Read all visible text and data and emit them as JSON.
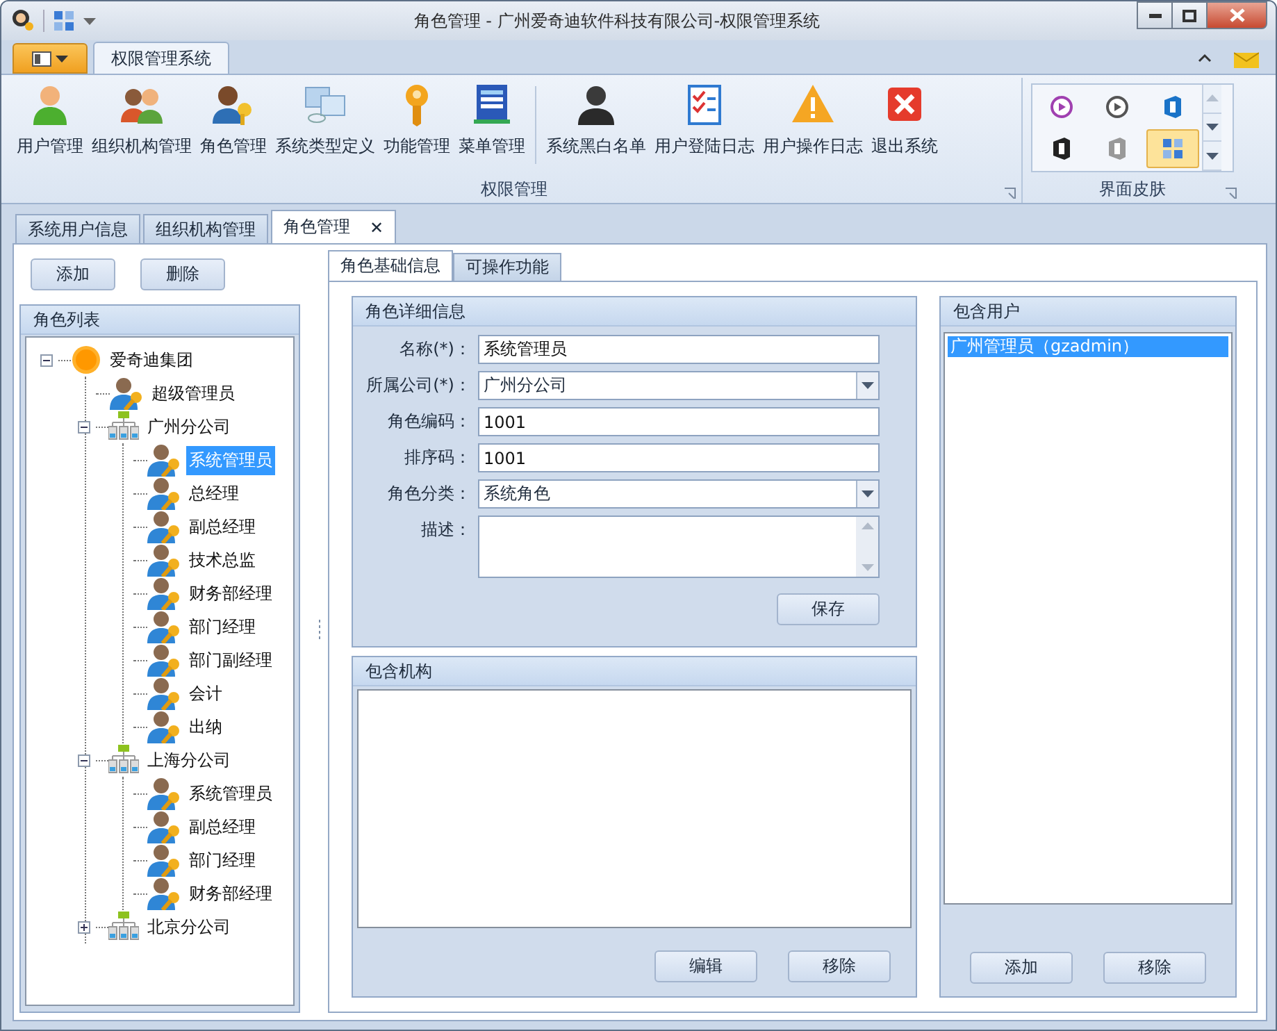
{
  "window": {
    "title": "角色管理 - 广州爱奇迪软件科技有限公司-权限管理系统"
  },
  "ribbon_tabs": [
    {
      "label": "权限管理系统",
      "selected": true
    }
  ],
  "ribbon_groups": [
    {
      "label": "权限管理",
      "sections": [
        [
          {
            "label": "用户管理"
          },
          {
            "label": "组织机构管理"
          },
          {
            "label": "角色管理"
          },
          {
            "label": "系统类型定义"
          },
          {
            "label": "功能管理"
          },
          {
            "label": "菜单管理"
          }
        ],
        [
          {
            "label": "系统黑白名单"
          },
          {
            "label": "用户登陆日志"
          },
          {
            "label": "用户操作日志"
          },
          {
            "label": "退出系统"
          }
        ]
      ]
    }
  ],
  "skin_group": {
    "label": "界面皮肤",
    "skins": [
      {
        "selected": false
      },
      {
        "selected": false
      },
      {
        "selected": false
      },
      {
        "selected": false
      },
      {
        "selected": false
      },
      {
        "selected": true
      }
    ]
  },
  "doc_tabs": [
    {
      "label": "系统用户信息",
      "selected": false
    },
    {
      "label": "组织机构管理",
      "selected": false
    },
    {
      "label": "角色管理",
      "selected": true,
      "close": "✕"
    }
  ],
  "left_buttons": [
    "添加",
    "删除"
  ],
  "role_list": {
    "title": "角色列表",
    "tree": [
      {
        "label": "爱奇迪集团",
        "kind": "root",
        "selected": false,
        "expanded": true,
        "children": [
          {
            "label": "超级管理员",
            "kind": "role",
            "selected": false
          },
          {
            "label": "广州分公司",
            "kind": "org",
            "selected": false,
            "expanded": true,
            "children": [
              {
                "label": "系统管理员",
                "kind": "role",
                "selected": true
              },
              {
                "label": "总经理",
                "kind": "role",
                "selected": false
              },
              {
                "label": "副总经理",
                "kind": "role",
                "selected": false
              },
              {
                "label": "技术总监",
                "kind": "role",
                "selected": false
              },
              {
                "label": "财务部经理",
                "kind": "role",
                "selected": false
              },
              {
                "label": "部门经理",
                "kind": "role",
                "selected": false
              },
              {
                "label": "部门副经理",
                "kind": "role",
                "selected": false
              },
              {
                "label": "会计",
                "kind": "role",
                "selected": false
              },
              {
                "label": "出纳",
                "kind": "role",
                "selected": false
              }
            ]
          },
          {
            "label": "上海分公司",
            "kind": "org",
            "selected": false,
            "expanded": true,
            "children": [
              {
                "label": "系统管理员",
                "kind": "role",
                "selected": false
              },
              {
                "label": "副总经理",
                "kind": "role",
                "selected": false
              },
              {
                "label": "部门经理",
                "kind": "role",
                "selected": false
              },
              {
                "label": "财务部经理",
                "kind": "role",
                "selected": false
              }
            ]
          },
          {
            "label": "北京分公司",
            "kind": "org",
            "selected": false,
            "expanded": false
          }
        ]
      }
    ]
  },
  "inner_tabs": [
    {
      "label": "角色基础信息",
      "selected": true
    },
    {
      "label": "可操作功能",
      "selected": false
    }
  ],
  "details": {
    "title": "角色详细信息",
    "fields": [
      {
        "label": "名称(*)：",
        "kind": "text",
        "value": "系统管理员"
      },
      {
        "label": "所属公司(*)：",
        "kind": "combo",
        "value": "广州分公司"
      },
      {
        "label": "角色编码：",
        "kind": "text",
        "value": "1001"
      },
      {
        "label": "排序码：",
        "kind": "text",
        "value": "1001"
      },
      {
        "label": "角色分类：",
        "kind": "combo",
        "value": "系统角色"
      },
      {
        "label": "描述：",
        "kind": "memo"
      }
    ],
    "button": "保存"
  },
  "orgs": {
    "title": "包含机构",
    "buttons": [
      "编辑",
      "移除"
    ]
  },
  "users": {
    "title": "包含用户",
    "items": [
      {
        "label": "广州管理员（gzadmin）",
        "selected": true
      }
    ],
    "buttons": [
      "添加",
      "移除"
    ]
  }
}
